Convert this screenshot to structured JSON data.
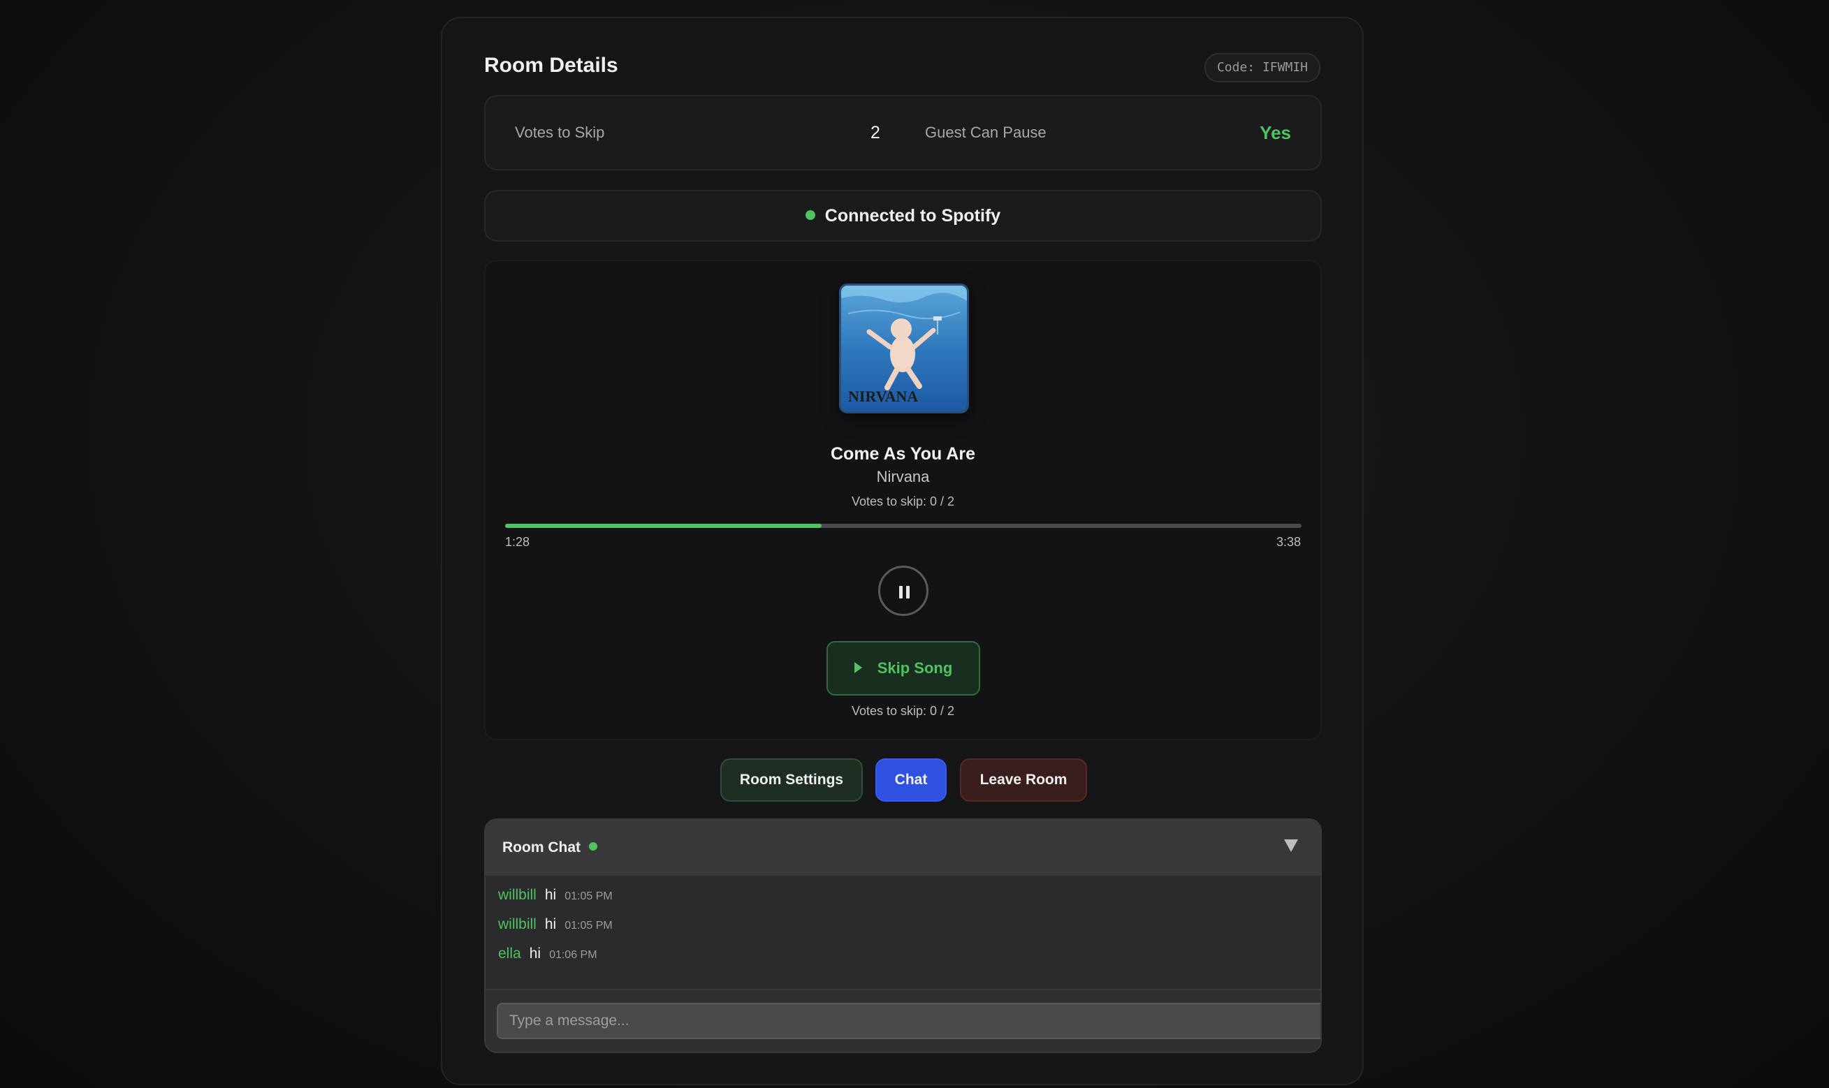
{
  "room": {
    "title": "Room Details",
    "code": "Code: IFWMIH"
  },
  "stats": {
    "votes_label": "Votes to Skip",
    "votes_value": "2",
    "pause_label": "Guest Can Pause",
    "pause_value": "Yes"
  },
  "status": {
    "text": "Connected to Spotify"
  },
  "player": {
    "album_logo_text": "NIRVANA",
    "song_title": "Come As You Are",
    "artist": "Nirvana",
    "votes_top": "Votes to skip: 0 / 2",
    "elapsed": "1:28",
    "duration": "3:38",
    "progress_fraction": 0.397,
    "skip_label": "Skip Song",
    "votes_bottom": "Votes to skip: 0 / 2"
  },
  "actions": {
    "settings": "Room Settings",
    "chat": "Chat",
    "leave": "Leave Room"
  },
  "chat": {
    "title": "Room Chat",
    "messages": [
      {
        "user": "willbill",
        "text": "hi",
        "time": "01:05 PM"
      },
      {
        "user": "willbill",
        "text": "hi",
        "time": "01:05 PM"
      },
      {
        "user": "ella",
        "text": "hi",
        "time": "01:06 PM"
      }
    ],
    "placeholder": "Type a message..."
  },
  "colors": {
    "accent": "#4fc35e",
    "chat_button": "#2f51e0",
    "leave_button": "#3a1d1d",
    "background": "#111113"
  },
  "icons": {
    "status": "status-dot-icon",
    "pause": "pause-icon",
    "skip": "play-icon",
    "chat_toggle": "triangle-down-icon"
  }
}
